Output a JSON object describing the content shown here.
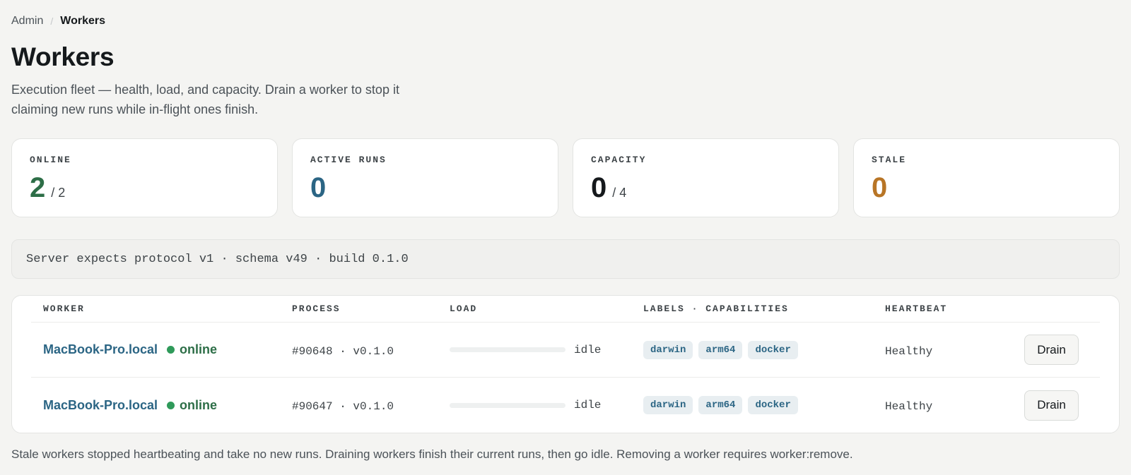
{
  "breadcrumb": {
    "root": "Admin",
    "separator": "/",
    "current": "Workers"
  },
  "page": {
    "title": "Workers",
    "description": "Execution fleet — health, load, and capacity. Drain a worker to stop it claiming new runs while in-flight ones finish."
  },
  "stats": [
    {
      "label": "ONLINE",
      "value": "2",
      "total": "/ 2",
      "color": "#2d6e47"
    },
    {
      "label": "ACTIVE RUNS",
      "value": "0",
      "total": "",
      "color": "#2b6584"
    },
    {
      "label": "CAPACITY",
      "value": "0",
      "total": "/ 4",
      "color": "#15191c"
    },
    {
      "label": "STALE",
      "value": "0",
      "total": "",
      "color": "#b87526"
    }
  ],
  "server_info": "Server expects protocol v1 · schema v49 · build 0.1.0",
  "table": {
    "headers": {
      "worker": "WORKER",
      "process": "PROCESS",
      "load": "LOAD",
      "labels": "LABELS · CAPABILITIES",
      "heartbeat": "HEARTBEAT"
    },
    "rows": [
      {
        "name": "MacBook-Pro.local",
        "status": "online",
        "process": "#90648 · v0.1.0",
        "load_fraction": 0,
        "load_text": "idle",
        "labels": [
          "darwin",
          "arm64",
          "docker"
        ],
        "heartbeat": "Healthy",
        "action": "Drain"
      },
      {
        "name": "MacBook-Pro.local",
        "status": "online",
        "process": "#90647 · v0.1.0",
        "load_fraction": 0,
        "load_text": "idle",
        "labels": [
          "darwin",
          "arm64",
          "docker"
        ],
        "heartbeat": "Healthy",
        "action": "Drain"
      }
    ]
  },
  "footer_note": "Stale workers stopped heartbeating and take no new runs. Draining workers finish their current runs, then go idle. Removing a worker requires worker:remove.",
  "colors": {
    "accent": "#2b6584",
    "online": "#2f9a5a",
    "stale": "#b87526"
  }
}
